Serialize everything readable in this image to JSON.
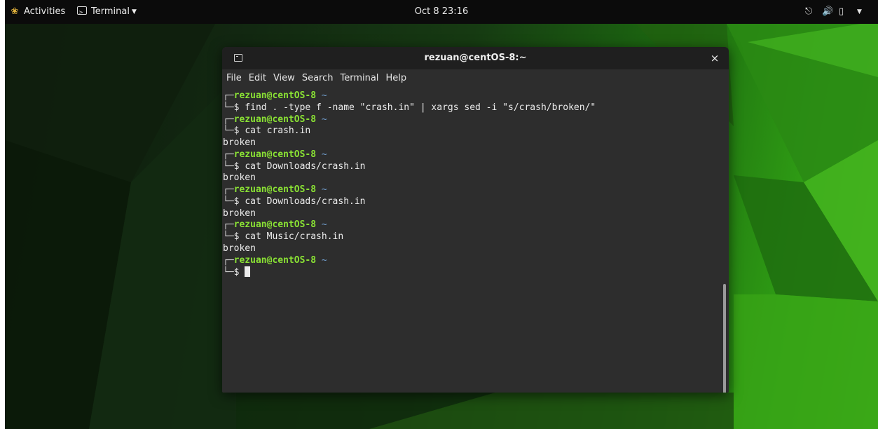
{
  "topbar": {
    "activities_label": "Activities",
    "app_menu_label": "Terminal",
    "clock": "Oct 8  23:16",
    "icons": [
      "gnome-foot-icon",
      "terminal-app-icon",
      "network-icon",
      "volume-icon",
      "battery-icon",
      "system-menu-caret-icon"
    ]
  },
  "window": {
    "title": "rezuan@centOS-8:~",
    "close_label": "×"
  },
  "menubar": {
    "items": [
      "File",
      "Edit",
      "View",
      "Search",
      "Terminal",
      "Help"
    ]
  },
  "terminal": {
    "prompt_user": "rezuan@centOS-8",
    "prompt_dir": "~",
    "sessions": [
      {
        "command": "find . -type f -name \"crash.in\" | xargs sed -i \"s/crash/broken/\"",
        "output": ""
      },
      {
        "command": "cat crash.in",
        "output": "broken"
      },
      {
        "command": "cat Downloads/crash.in",
        "output": "broken"
      },
      {
        "command": "cat Downloads/crash.in",
        "output": "broken"
      },
      {
        "command": "cat Music/crash.in",
        "output": "broken"
      }
    ],
    "current_input": ""
  },
  "colors": {
    "prompt_user": "#8ae234",
    "prompt_dir": "#729fcf",
    "terminal_bg": "#2d2d2d",
    "titlebar_bg": "#1f1f1f",
    "topbar_bg": "#0b0b0b"
  }
}
